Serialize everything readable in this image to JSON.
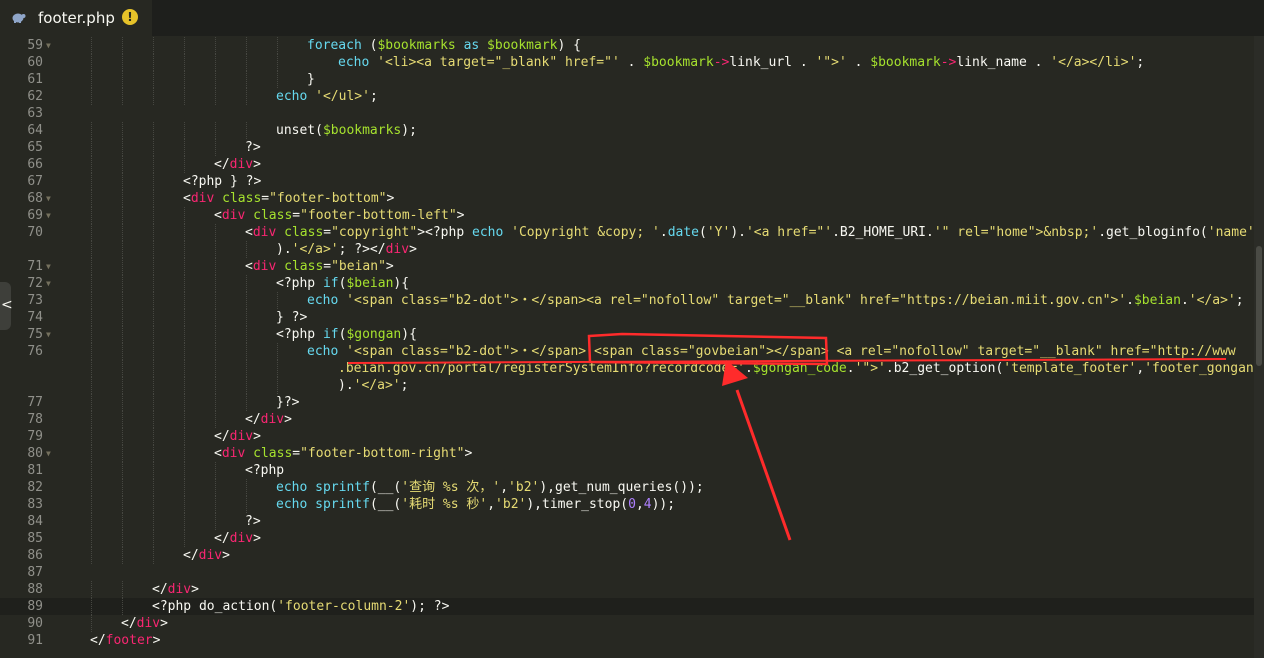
{
  "tab": {
    "filename": "footer.php",
    "warning_symbol": "!"
  },
  "nav": {
    "collapse_symbol": "<"
  },
  "colors": {
    "background": "#272822",
    "keyword": "#66d9ef",
    "string": "#e6db74",
    "tag": "#f92672",
    "attribute": "#a6e22e",
    "number": "#ae81ff",
    "annotation": "#ff2b2b"
  },
  "lines": [
    {
      "n": "59",
      "fold": true,
      "parts": [
        [
          "k",
          "foreach"
        ],
        [
          "p",
          " ("
        ],
        [
          "v",
          "$bookmarks"
        ],
        [
          "p",
          " "
        ],
        [
          "k",
          "as"
        ],
        [
          "p",
          " "
        ],
        [
          "v",
          "$bookmark"
        ],
        [
          "p",
          ") {"
        ]
      ]
    },
    {
      "n": "60",
      "parts": [
        [
          "k",
          "echo"
        ],
        [
          "p",
          " "
        ],
        [
          "s",
          "'<li><a target=\"_blank\" href=\"'"
        ],
        [
          "p",
          " . "
        ],
        [
          "v",
          "$bookmark"
        ],
        [
          "t",
          "->"
        ],
        [
          "p",
          "link_url . "
        ],
        [
          "s",
          "'\">'"
        ],
        [
          "p",
          " . "
        ],
        [
          "v",
          "$bookmark"
        ],
        [
          "t",
          "->"
        ],
        [
          "p",
          "link_name . "
        ],
        [
          "s",
          "'</a></li>'"
        ],
        [
          "p",
          ";"
        ]
      ]
    },
    {
      "n": "61",
      "parts": [
        [
          "p",
          "}"
        ]
      ]
    },
    {
      "n": "62",
      "parts": [
        [
          "k",
          "echo"
        ],
        [
          "p",
          " "
        ],
        [
          "s",
          "'</ul>'"
        ],
        [
          "p",
          ";"
        ]
      ]
    },
    {
      "n": "63",
      "parts": []
    },
    {
      "n": "64",
      "parts": [
        [
          "p",
          "unset("
        ],
        [
          "v",
          "$bookmarks"
        ],
        [
          "p",
          ");"
        ]
      ]
    },
    {
      "n": "65",
      "parts": [
        [
          "p",
          "?>"
        ]
      ]
    },
    {
      "n": "66",
      "parts": [
        [
          "p",
          "</"
        ],
        [
          "t",
          "div"
        ],
        [
          "p",
          ">"
        ]
      ]
    },
    {
      "n": "67",
      "parts": [
        [
          "p",
          "<?php } ?>"
        ]
      ]
    },
    {
      "n": "68",
      "fold": true,
      "parts": [
        [
          "p",
          "<"
        ],
        [
          "t",
          "div"
        ],
        [
          "p",
          " "
        ],
        [
          "a",
          "class"
        ],
        [
          "p",
          "="
        ],
        [
          "s",
          "\"footer-bottom\""
        ],
        [
          "p",
          ">"
        ]
      ]
    },
    {
      "n": "69",
      "fold": true,
      "parts": [
        [
          "p",
          "<"
        ],
        [
          "t",
          "div"
        ],
        [
          "p",
          " "
        ],
        [
          "a",
          "class"
        ],
        [
          "p",
          "="
        ],
        [
          "s",
          "\"footer-bottom-left\""
        ],
        [
          "p",
          ">"
        ]
      ]
    },
    {
      "n": "70",
      "parts": [
        [
          "p",
          "<"
        ],
        [
          "t",
          "div"
        ],
        [
          "p",
          " "
        ],
        [
          "a",
          "class"
        ],
        [
          "p",
          "="
        ],
        [
          "s",
          "\"copyright\""
        ],
        [
          "p",
          ">"
        ],
        [
          "p",
          "<?php "
        ],
        [
          "k",
          "echo"
        ],
        [
          "p",
          " "
        ],
        [
          "s",
          "'Copyright &copy; '"
        ],
        [
          "p",
          "."
        ],
        [
          "k",
          "date"
        ],
        [
          "p",
          "("
        ],
        [
          "s",
          "'Y'"
        ],
        [
          "p",
          ")."
        ],
        [
          "s",
          "'<a href=\"'"
        ],
        [
          "p",
          ".B2_HOME_URI."
        ],
        [
          "s",
          "'\" rel=\"home\">&nbsp;'"
        ],
        [
          "p",
          ".get_bloginfo("
        ],
        [
          "s",
          "'name'"
        ]
      ]
    },
    {
      "n": "",
      "parts": [
        [
          "p",
          ")."
        ],
        [
          "s",
          "'</a>'"
        ],
        [
          "p",
          "; ?></"
        ],
        [
          "t",
          "div"
        ],
        [
          "p",
          ">"
        ]
      ]
    },
    {
      "n": "71",
      "fold": true,
      "parts": [
        [
          "p",
          "<"
        ],
        [
          "t",
          "div"
        ],
        [
          "p",
          " "
        ],
        [
          "a",
          "class"
        ],
        [
          "p",
          "="
        ],
        [
          "s",
          "\"beian\""
        ],
        [
          "p",
          ">"
        ]
      ]
    },
    {
      "n": "72",
      "fold": true,
      "parts": [
        [
          "p",
          "<?php "
        ],
        [
          "k",
          "if"
        ],
        [
          "p",
          "("
        ],
        [
          "v",
          "$beian"
        ],
        [
          "p",
          "){"
        ]
      ]
    },
    {
      "n": "73",
      "parts": [
        [
          "k",
          "echo"
        ],
        [
          "p",
          " "
        ],
        [
          "s",
          "'<span class=\"b2-dot\">・</span><a rel=\"nofollow\" target=\"__blank\" href=\"https://beian.miit.gov.cn\">'"
        ],
        [
          "p",
          "."
        ],
        [
          "v",
          "$beian"
        ],
        [
          "p",
          "."
        ],
        [
          "s",
          "'</a>'"
        ],
        [
          "p",
          ";"
        ]
      ]
    },
    {
      "n": "74",
      "parts": [
        [
          "p",
          "} ?>"
        ]
      ]
    },
    {
      "n": "75",
      "fold": true,
      "parts": [
        [
          "p",
          "<?php "
        ],
        [
          "k",
          "if"
        ],
        [
          "p",
          "("
        ],
        [
          "v",
          "$gongan"
        ],
        [
          "p",
          "){"
        ]
      ]
    },
    {
      "n": "76",
      "parts": [
        [
          "k",
          "echo"
        ],
        [
          "p",
          " "
        ],
        [
          "s",
          "'<span class=\"b2-dot\">・</span> <span class=\"govbeian\"></span> <a rel=\"nofollow\" target=\"__blank\" href=\"http://www"
        ]
      ]
    },
    {
      "n": "",
      "parts": [
        [
          "s",
          ".beian.gov.cn/portal/registerSystemInfo?recordcode='"
        ],
        [
          "p",
          "."
        ],
        [
          "v",
          "$gongan_code"
        ],
        [
          "p",
          "."
        ],
        [
          "s",
          "'\">'"
        ],
        [
          "p",
          ".b2_get_option("
        ],
        [
          "s",
          "'template_footer'"
        ],
        [
          "p",
          ","
        ],
        [
          "s",
          "'footer_gongan'"
        ]
      ]
    },
    {
      "n": "",
      "parts": [
        [
          "p",
          ")."
        ],
        [
          "s",
          "'</a>'"
        ],
        [
          "p",
          ";"
        ]
      ]
    },
    {
      "n": "77",
      "parts": [
        [
          "p",
          "}?>"
        ]
      ]
    },
    {
      "n": "78",
      "parts": [
        [
          "p",
          "</"
        ],
        [
          "t",
          "div"
        ],
        [
          "p",
          ">"
        ]
      ]
    },
    {
      "n": "79",
      "parts": [
        [
          "p",
          "</"
        ],
        [
          "t",
          "div"
        ],
        [
          "p",
          ">"
        ]
      ]
    },
    {
      "n": "80",
      "fold": true,
      "parts": [
        [
          "p",
          "<"
        ],
        [
          "t",
          "div"
        ],
        [
          "p",
          " "
        ],
        [
          "a",
          "class"
        ],
        [
          "p",
          "="
        ],
        [
          "s",
          "\"footer-bottom-right\""
        ],
        [
          "p",
          ">"
        ]
      ]
    },
    {
      "n": "81",
      "parts": [
        [
          "p",
          "<?php"
        ]
      ]
    },
    {
      "n": "82",
      "parts": [
        [
          "k",
          "echo"
        ],
        [
          "p",
          " "
        ],
        [
          "k",
          "sprintf"
        ],
        [
          "p",
          "(__("
        ],
        [
          "s",
          "'查询 %s 次，'"
        ],
        [
          "p",
          ","
        ],
        [
          "s",
          "'b2'"
        ],
        [
          "p",
          "),get_num_queries());"
        ]
      ]
    },
    {
      "n": "83",
      "parts": [
        [
          "k",
          "echo"
        ],
        [
          "p",
          " "
        ],
        [
          "k",
          "sprintf"
        ],
        [
          "p",
          "(__("
        ],
        [
          "s",
          "'耗时 %s 秒'"
        ],
        [
          "p",
          ","
        ],
        [
          "s",
          "'b2'"
        ],
        [
          "p",
          "),timer_stop("
        ],
        [
          "n",
          "0"
        ],
        [
          "p",
          ","
        ],
        [
          "n",
          "4"
        ],
        [
          "p",
          "));"
        ]
      ]
    },
    {
      "n": "84",
      "parts": [
        [
          "p",
          "?>"
        ]
      ]
    },
    {
      "n": "85",
      "parts": [
        [
          "p",
          "</"
        ],
        [
          "t",
          "div"
        ],
        [
          "p",
          ">"
        ]
      ]
    },
    {
      "n": "86",
      "parts": [
        [
          "p",
          "</"
        ],
        [
          "t",
          "div"
        ],
        [
          "p",
          ">"
        ]
      ]
    },
    {
      "n": "87",
      "parts": []
    },
    {
      "n": "88",
      "parts": [
        [
          "p",
          "</"
        ],
        [
          "t",
          "div"
        ],
        [
          "p",
          ">"
        ]
      ]
    },
    {
      "n": "89",
      "active": true,
      "parts": [
        [
          "p",
          "<?php do_action("
        ],
        [
          "s",
          "'footer-column-2'"
        ],
        [
          "p",
          "); ?>"
        ]
      ]
    },
    {
      "n": "90",
      "parts": [
        [
          "p",
          "</"
        ],
        [
          "t",
          "div"
        ],
        [
          "p",
          ">"
        ]
      ]
    },
    {
      "n": "91",
      "parts": [
        [
          "p",
          "</"
        ],
        [
          "t",
          "footer"
        ],
        [
          "p",
          ">"
        ]
      ]
    }
  ]
}
